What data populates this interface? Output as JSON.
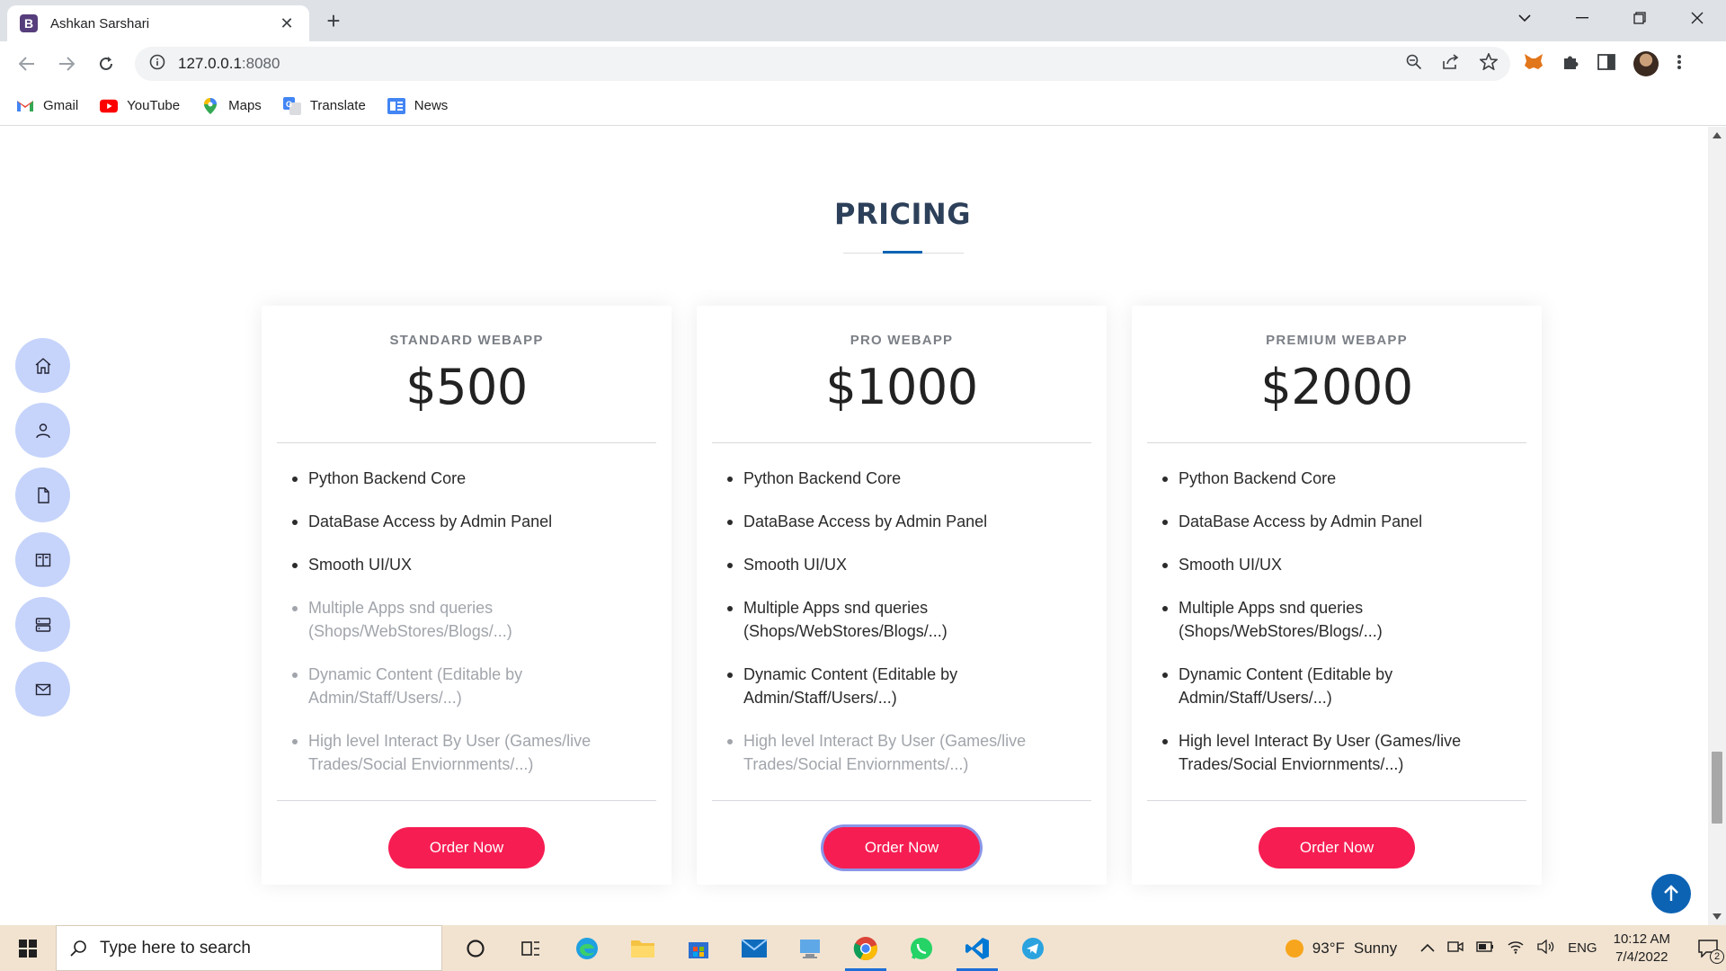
{
  "browser": {
    "tab_title": "Ashkan Sarshari",
    "tab_favicon": "B",
    "url_host": "127.0.0.1",
    "url_port": ":8080",
    "bookmarks": [
      {
        "label": "Gmail",
        "icon": "gmail-icon",
        "color": "#ea4335"
      },
      {
        "label": "YouTube",
        "icon": "youtube-icon",
        "color": "#ff0000"
      },
      {
        "label": "Maps",
        "icon": "maps-icon",
        "color": "#34a853"
      },
      {
        "label": "Translate",
        "icon": "translate-icon",
        "color": "#4285f4"
      },
      {
        "label": "News",
        "icon": "news-icon",
        "color": "#4285f4"
      }
    ]
  },
  "page": {
    "section_title": "PRICING",
    "plans": [
      {
        "name": "STANDARD WEBAPP",
        "price": "$500",
        "features": [
          {
            "text": "Python Backend Core",
            "included": true
          },
          {
            "text": "DataBase Access by Admin Panel",
            "included": true
          },
          {
            "text": "Smooth UI/UX",
            "included": true
          },
          {
            "text": "Multiple Apps snd queries (Shops/WebStores/Blogs/...)",
            "included": false
          },
          {
            "text": "Dynamic Content (Editable by Admin/Staff/Users/...)",
            "included": false
          },
          {
            "text": "High level Interact By User (Games/live Trades/Social Enviornments/...)",
            "included": false
          }
        ],
        "button": "Order Now"
      },
      {
        "name": "PRO WEBAPP",
        "price": "$1000",
        "features": [
          {
            "text": "Python Backend Core",
            "included": true
          },
          {
            "text": "DataBase Access by Admin Panel",
            "included": true
          },
          {
            "text": "Smooth UI/UX",
            "included": true
          },
          {
            "text": "Multiple Apps snd queries (Shops/WebStores/Blogs/...)",
            "included": true
          },
          {
            "text": "Dynamic Content (Editable by Admin/Staff/Users/...)",
            "included": true
          },
          {
            "text": "High level Interact By User (Games/live Trades/Social Enviornments/...)",
            "included": false
          }
        ],
        "button": "Order Now"
      },
      {
        "name": "PREMIUM WEBAPP",
        "price": "$2000",
        "features": [
          {
            "text": "Python Backend Core",
            "included": true
          },
          {
            "text": "DataBase Access by Admin Panel",
            "included": true
          },
          {
            "text": "Smooth UI/UX",
            "included": true
          },
          {
            "text": "Multiple Apps snd queries (Shops/WebStores/Blogs/...)",
            "included": true
          },
          {
            "text": "Dynamic Content (Editable by Admin/Staff/Users/...)",
            "included": true
          },
          {
            "text": "High level Interact By User (Games/live Trades/Social Enviornments/...)",
            "included": true
          }
        ],
        "button": "Order Now"
      }
    ],
    "colors": {
      "accent": "#f61d52",
      "title": "#2d405a",
      "primary": "#0d63b3",
      "sidenav": "#c6d4fb"
    }
  },
  "taskbar": {
    "search_placeholder": "Type here to search",
    "weather_temp": "93°F",
    "weather_desc": "Sunny",
    "language": "ENG",
    "time": "10:12 AM",
    "date": "7/4/2022",
    "notification_count": "2"
  }
}
